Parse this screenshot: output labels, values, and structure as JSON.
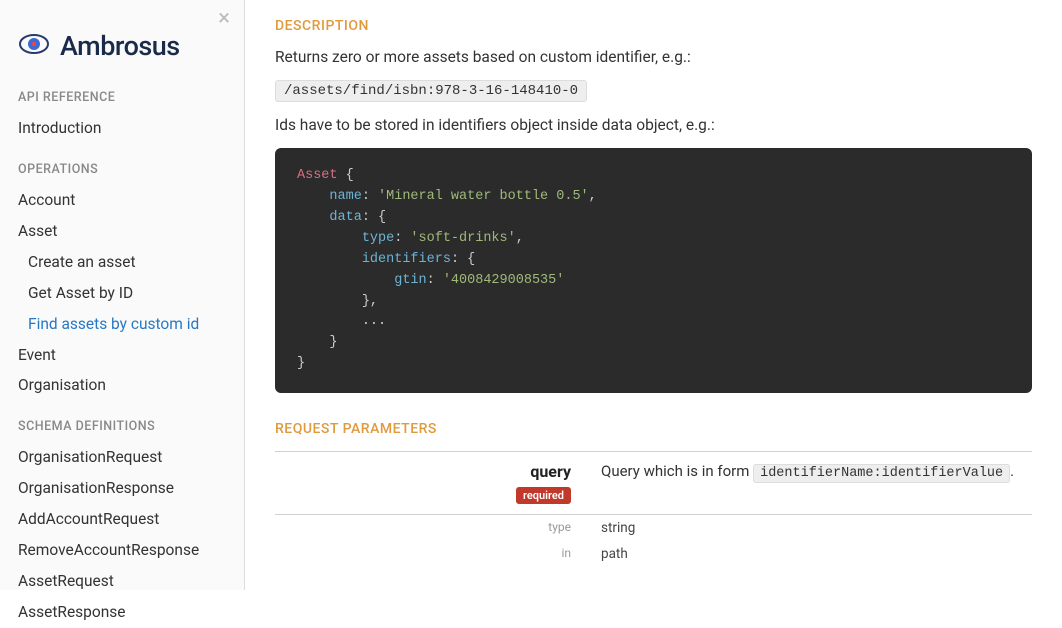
{
  "brand": {
    "name": "Ambrosus"
  },
  "sidebar": {
    "sections": [
      {
        "heading": "API REFERENCE",
        "items": [
          "Introduction"
        ]
      },
      {
        "heading": "OPERATIONS",
        "items": [
          "Account",
          "Asset",
          "Create an asset",
          "Get Asset by ID",
          "Find assets by custom id",
          "Event",
          "Organisation"
        ]
      },
      {
        "heading": "SCHEMA DEFINITIONS",
        "items": [
          "OrganisationRequest",
          "OrganisationResponse",
          "AddAccountRequest",
          "RemoveAccountResponse",
          "AssetRequest",
          "AssetResponse"
        ]
      }
    ]
  },
  "description": {
    "heading": "DESCRIPTION",
    "line1": "Returns zero or more assets based on custom identifier, e.g.:",
    "example_path": "/assets/find/isbn:978-3-16-148410-0",
    "line2": "Ids have to be stored in identifiers object inside data object, e.g.:",
    "code": {
      "kw_asset": "Asset",
      "key_name": "name",
      "val_name": "'Mineral water bottle 0.5'",
      "key_data": "data",
      "key_type": "type",
      "val_type": "'soft-drinks'",
      "key_identifiers": "identifiers",
      "key_gtin": "gtin",
      "val_gtin": "'4008429008535'",
      "ellipsis": "..."
    }
  },
  "params": {
    "heading": "REQUEST PARAMETERS",
    "query": {
      "name": "query",
      "required_label": "required",
      "desc_prefix": "Query which is in form ",
      "desc_code": "identifierName:identifierValue",
      "desc_suffix": ".",
      "type_label": "type",
      "type_value": "string",
      "in_label": "in",
      "in_value": "path"
    }
  }
}
